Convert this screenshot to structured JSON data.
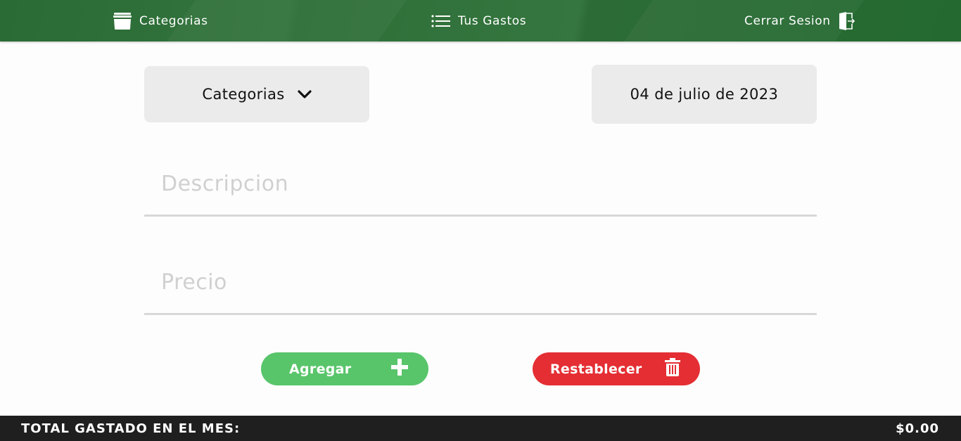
{
  "header": {
    "nav": {
      "categorias": "Categorias",
      "gastos": "Tus Gastos",
      "cerrar": "Cerrar Sesion"
    },
    "icons": {
      "categorias": "archive-box-icon",
      "gastos": "list-icon",
      "cerrar": "logout-door-icon"
    }
  },
  "form": {
    "category_select": "Categorias",
    "date": "04 de julio de 2023",
    "description_placeholder": "Descripcion",
    "description_value": "",
    "price_placeholder": "Precio",
    "price_value": ""
  },
  "buttons": {
    "add_label": "Agregar",
    "reset_label": "Restablecer"
  },
  "footer": {
    "total_label": "TOTAL GASTADO EN EL MES:",
    "total_value": "$0.00"
  },
  "colors": {
    "header": "#2e6f38",
    "add_button": "#58c56a",
    "reset_button": "#e42e33",
    "footer": "#1f1f1f"
  }
}
